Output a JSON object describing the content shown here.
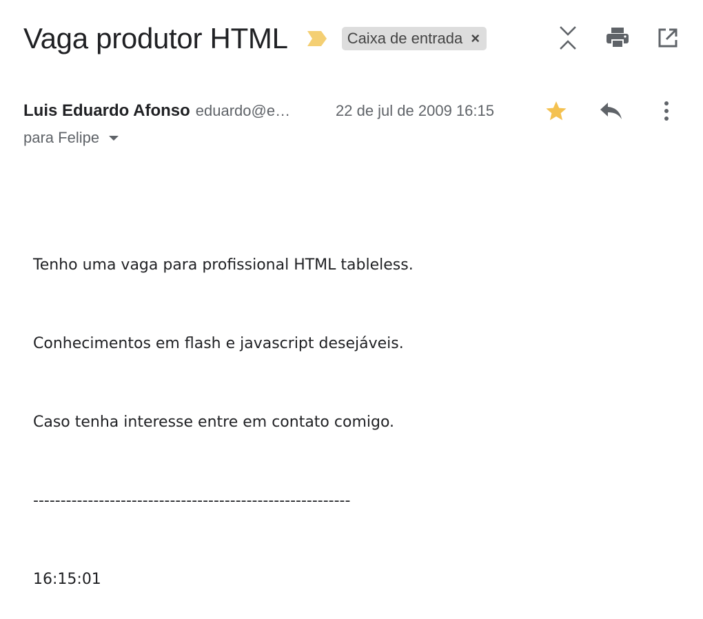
{
  "email": {
    "subject": "Vaga produtor HTML",
    "label": "Caixa de entrada",
    "label_close": "×",
    "sender_name": "Luis Eduardo Afonso",
    "sender_email": "eduardo@e…",
    "date": "22 de jul de 2009 16:15",
    "recipient": "para Felipe",
    "body_lines": [
      "Tenho uma vaga para profissional HTML tableless.",
      "Conhecimentos em flash e javascript desejáveis.",
      "Caso tenha interesse entre em contato comigo.",
      "----------------------------------------------------------",
      "16:15:01"
    ],
    "starred": true
  },
  "icons": {
    "importance": "important-marker-icon",
    "expand": "collapse-all-icon",
    "print": "print-icon",
    "new_window": "open-in-new-window-icon",
    "star": "star-icon",
    "reply": "reply-icon",
    "more": "more-options-icon"
  },
  "colors": {
    "importance_marker": "#f4cf73",
    "star": "#f4c150",
    "icon_gray": "#5f6368",
    "chip_bg": "#dddddd"
  }
}
